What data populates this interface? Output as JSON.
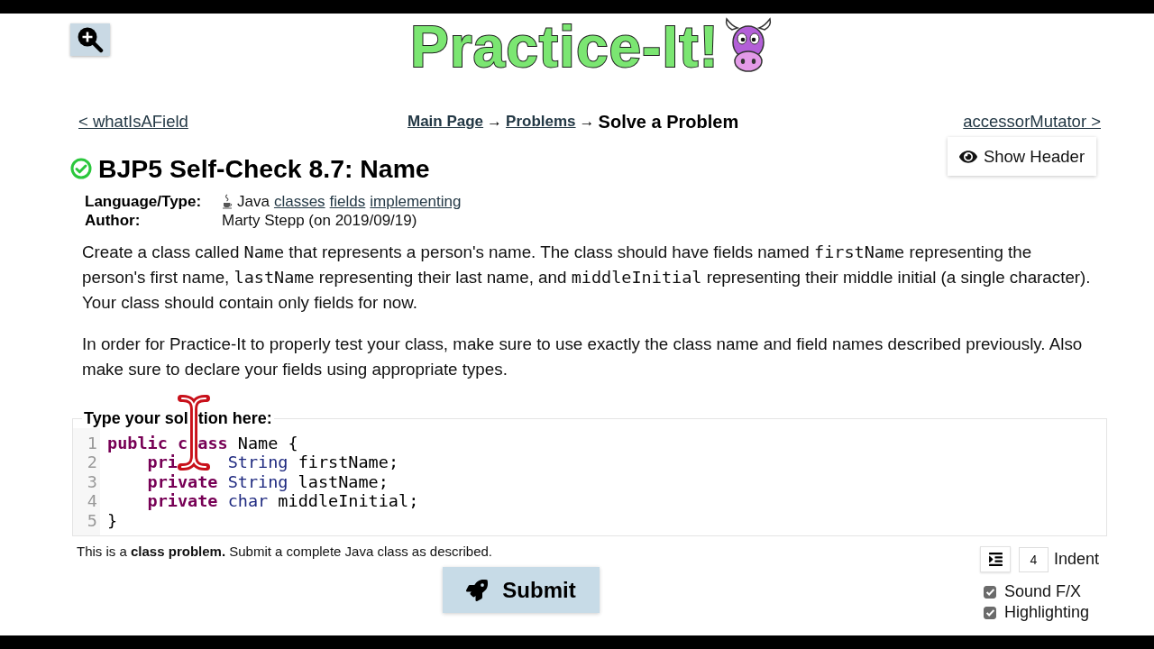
{
  "logo": "Practice-It!",
  "nav": {
    "previous": "< whatIsAField",
    "breadcrumb": [
      {
        "kind": "link",
        "text": "Main Page"
      },
      {
        "kind": "separator",
        "text": "→"
      },
      {
        "kind": "link",
        "text": "Problems"
      },
      {
        "kind": "separator",
        "text": "→"
      },
      {
        "kind": "current",
        "text": "Solve a Problem"
      }
    ],
    "next": "accessorMutator >"
  },
  "show_header": "Show Header",
  "problem": {
    "title": "BJP5 Self-Check 8.7: Name",
    "solved": true
  },
  "meta": [
    {
      "kind": "language",
      "label": "Language/Type:",
      "text": "Java",
      "tags": [
        "classes",
        "fields",
        "implementing"
      ]
    },
    {
      "kind": "author",
      "label": "Author:",
      "text": "Marty Stepp (on 2019/09/19)"
    }
  ],
  "description": [
    {
      "segments": [
        {
          "kind": "text",
          "text": "Create a class called "
        },
        {
          "kind": "code",
          "text": "Name"
        },
        {
          "kind": "text",
          "text": " that represents a person's name. The class should have fields named "
        },
        {
          "kind": "code",
          "text": "firstName"
        },
        {
          "kind": "text",
          "text": " representing the person's first name, "
        },
        {
          "kind": "code",
          "text": "lastName"
        },
        {
          "kind": "text",
          "text": " representing their last name, and "
        },
        {
          "kind": "code",
          "text": "middleInitial"
        },
        {
          "kind": "text",
          "text": " representing their middle initial (a single character). Your class should contain only fields for now."
        }
      ]
    },
    {
      "segments": [
        {
          "kind": "text",
          "text": "In order for Practice-It to properly test your class, make sure to use exactly the class name and field names described previously. Also make sure to declare your fields using appropriate types."
        }
      ]
    }
  ],
  "editor": {
    "legend": [
      "Type your sol",
      "tion here:"
    ],
    "lines": [
      {
        "number": "1",
        "tokens": [
          {
            "kind": "keyword",
            "text": "public"
          },
          {
            "kind": "keyword",
            "text": " c"
          },
          {
            "kind": "keyword",
            "text": " ass"
          },
          {
            "kind": "plain",
            "text": " Name {"
          }
        ],
        "children": [
          {
            "number": "2",
            "tokens": [
              {
                "kind": "keyword",
                "text": "pri"
              },
              {
                "kind": "type",
                "text": "     String"
              },
              {
                "kind": "plain",
                "text": " firstName;"
              }
            ]
          },
          {
            "number": "3",
            "tokens": [
              {
                "kind": "keyword",
                "text": "private"
              },
              {
                "kind": "type",
                "text": " String"
              },
              {
                "kind": "plain",
                "text": " lastName;"
              }
            ]
          },
          {
            "number": "4",
            "tokens": [
              {
                "kind": "keyword",
                "text": "private"
              },
              {
                "kind": "type",
                "text": " char"
              },
              {
                "kind": "plain",
                "text": " middleInitial;"
              }
            ]
          }
        ]
      },
      {
        "number": "5",
        "tokens": [
          {
            "kind": "plain",
            "text": "}"
          }
        ]
      }
    ]
  },
  "note": "This is a **class problem.** Submit a complete Java class as described.",
  "submit": "Submit",
  "indent": {
    "value": "4",
    "label": "Indent"
  },
  "options": [
    {
      "label": "Sound F/X",
      "checked": true
    },
    {
      "label": "Highlighting",
      "checked": true
    }
  ]
}
